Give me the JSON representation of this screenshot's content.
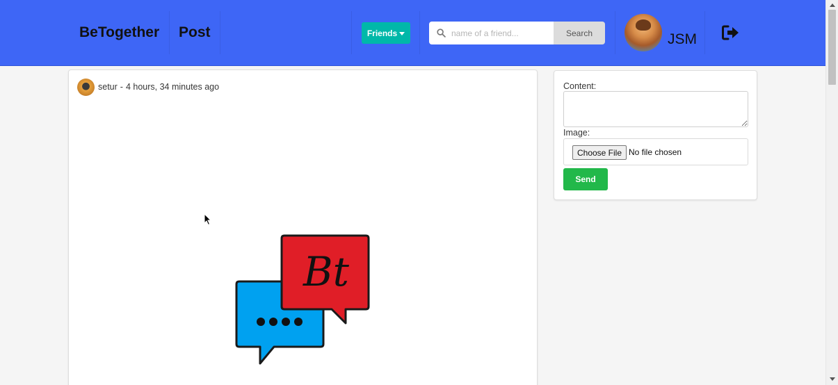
{
  "navbar": {
    "brand": "BeTogether",
    "post_link": "Post",
    "friends_button": "Friends",
    "search": {
      "placeholder": "name of a friend...",
      "value": "",
      "button_label": "Search"
    },
    "user": {
      "name": "JSM",
      "avatar": "user-avatar"
    },
    "logout_icon": "sign-out-icon",
    "colors": {
      "background": "#3e66f6",
      "friends_button": "#00b8a9"
    }
  },
  "post": {
    "author": "setur",
    "separator": "-",
    "time_ago": "4 hours, 34 minutes ago",
    "image": {
      "logo_text": "Bt",
      "description_icon": "chat-bubbles-logo"
    }
  },
  "new_post_form": {
    "content_label": "Content:",
    "content_value": "",
    "image_label": "Image:",
    "choose_file_label": "Choose File",
    "file_status": "No file chosen",
    "send_label": "Send",
    "colors": {
      "send_button": "#22b84a"
    }
  }
}
